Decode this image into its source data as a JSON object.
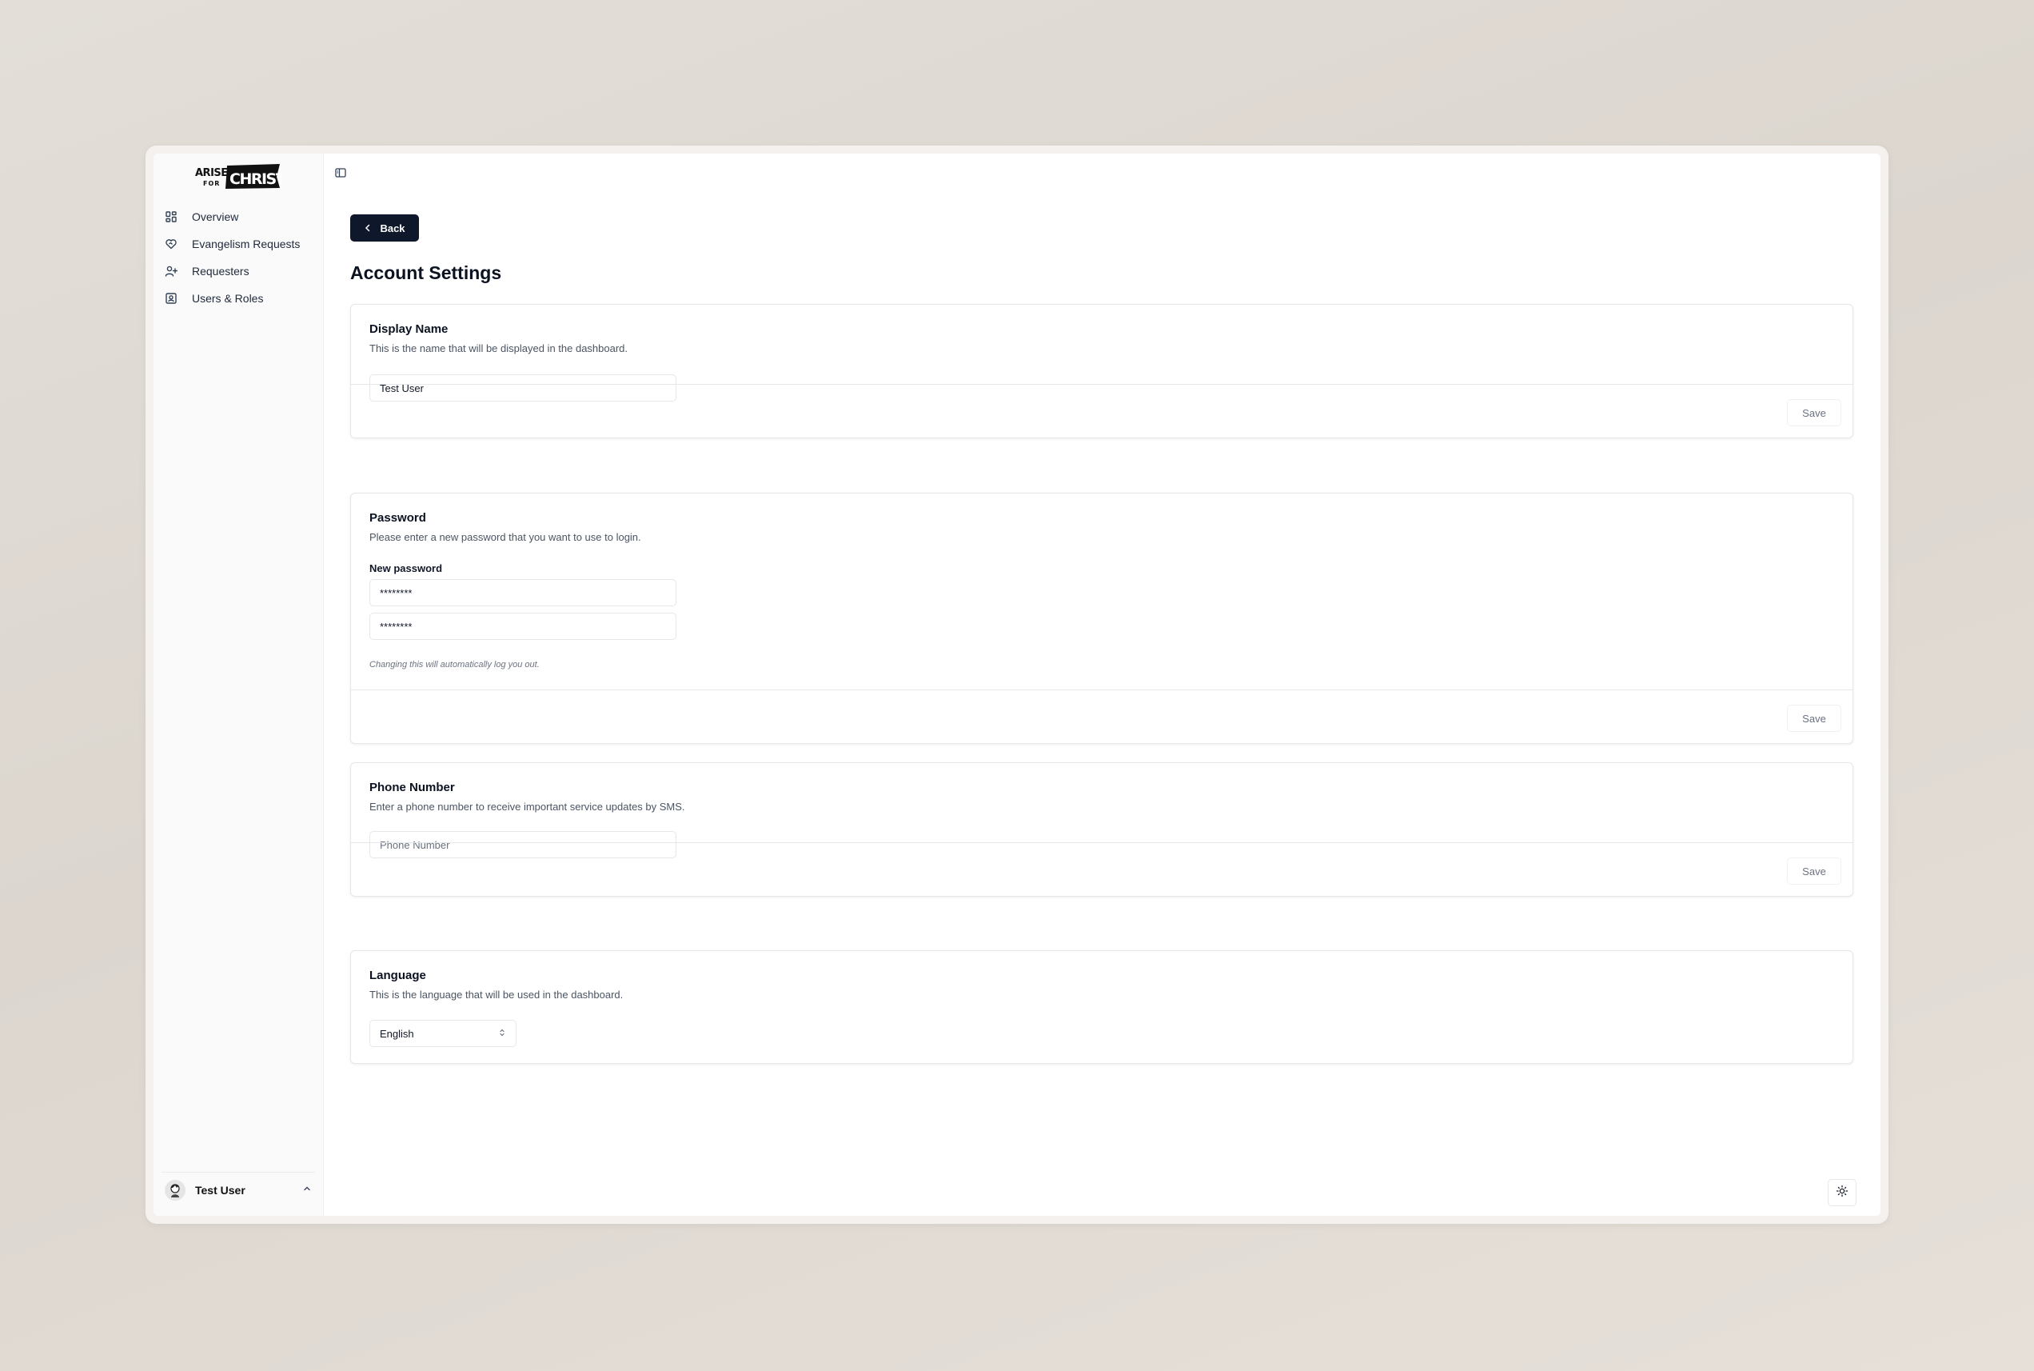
{
  "brand": {
    "logo_line1": "ARISE",
    "logo_line2": "FOR",
    "logo_word": "CHRIST"
  },
  "sidebar": {
    "items": [
      {
        "label": "Overview",
        "icon": "grid-icon"
      },
      {
        "label": "Evangelism Requests",
        "icon": "heart-handshake-icon"
      },
      {
        "label": "Requesters",
        "icon": "user-plus-icon"
      },
      {
        "label": "Users & Roles",
        "icon": "contact-card-icon"
      }
    ],
    "user": {
      "name": "Test User"
    }
  },
  "header": {
    "back_label": "Back",
    "page_title": "Account Settings"
  },
  "cards": {
    "display_name": {
      "title": "Display Name",
      "description": "This is the name that will be displayed in the dashboard.",
      "value": "Test User",
      "save_label": "Save"
    },
    "password": {
      "title": "Password",
      "description": "Please enter a new password that you want to use to login.",
      "field_label": "New password",
      "value1": "********",
      "value2": "********",
      "hint": "Changing this will automatically log you out.",
      "save_label": "Save"
    },
    "phone": {
      "title": "Phone Number",
      "description": "Enter a phone number to receive important service updates by SMS.",
      "placeholder": "Phone Number",
      "save_label": "Save"
    },
    "language": {
      "title": "Language",
      "description": "This is the language that will be used in the dashboard.",
      "selected": "English"
    }
  },
  "colors": {
    "primary": "#0f172a",
    "border": "#e5e7eb",
    "muted_text": "#4b5563"
  }
}
